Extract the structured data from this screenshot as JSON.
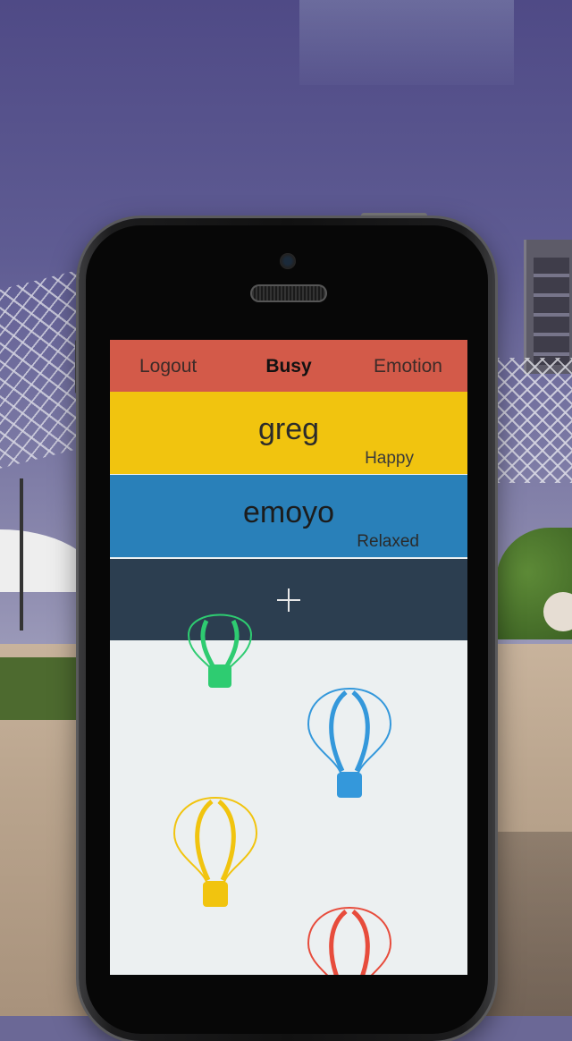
{
  "navbar": {
    "left_label": "Logout",
    "title": "Busy",
    "right_label": "Emotion"
  },
  "contacts": [
    {
      "name": "greg",
      "status": "Happy",
      "color": "#f1c40f"
    },
    {
      "name": "emoyo",
      "status": "Relaxed",
      "color": "#2980b9"
    }
  ],
  "add_row": {
    "icon": "plus-icon",
    "color": "#2c3e50"
  },
  "colors": {
    "navbar": "#d35a49",
    "background": "#ecf0f1",
    "balloon_green": "#2ecc71",
    "balloon_blue": "#3498db",
    "balloon_yellow": "#f1c40f",
    "balloon_red": "#e74c3c"
  },
  "decorations": [
    "green-balloon-icon",
    "blue-balloon-icon",
    "yellow-balloon-icon",
    "red-balloon-icon"
  ]
}
